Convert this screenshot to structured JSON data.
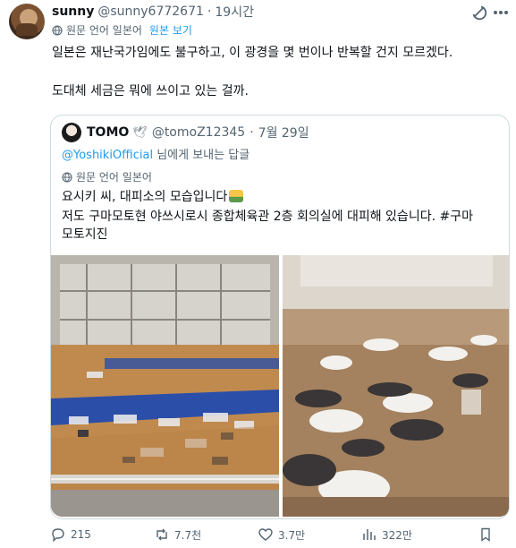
{
  "tweet": {
    "display_name": "sunny",
    "handle": "@sunny6772671",
    "separator": "·",
    "time": "19시간",
    "translation_label": "원문 언어 일본어",
    "show_original": "원본 보기",
    "text_line1": "일본은 재난국가임에도 불구하고, 이 광경을 몇 번이나 반복할 건지 모르겠다.",
    "text_line2": "도대체 세금은 뭐에 쓰이고 있는 걸까.",
    "stats": {
      "replies": "215",
      "retweets": "7.7천",
      "likes": "3.7만",
      "views": "322만"
    }
  },
  "quoted": {
    "display_name": "TOMO",
    "badge": "🕊",
    "handle": "@tomoZ12345",
    "separator": "·",
    "date": "7월 29일",
    "reply_mention": "@YoshikiOfficial",
    "reply_suffix": " 님에게 보내는 답글",
    "translation_label": "원문 언어 일본어",
    "text_line1": "요시키 씨, 대피소의 모습입니다",
    "text_line2": "저도 구마모토현 야쓰시로시 종합체육관 2층 회의실에 대피해 있습니다. #구마",
    "text_line3": "모토지진"
  },
  "colors": {
    "accent": "#1d9bf0",
    "muted": "#536471",
    "text": "#0f1419",
    "border": "#cfd9de"
  },
  "icons": [
    "grok-icon",
    "more-icon",
    "globe-icon",
    "reply-icon",
    "retweet-icon",
    "like-icon",
    "views-icon",
    "bookmark-icon"
  ]
}
